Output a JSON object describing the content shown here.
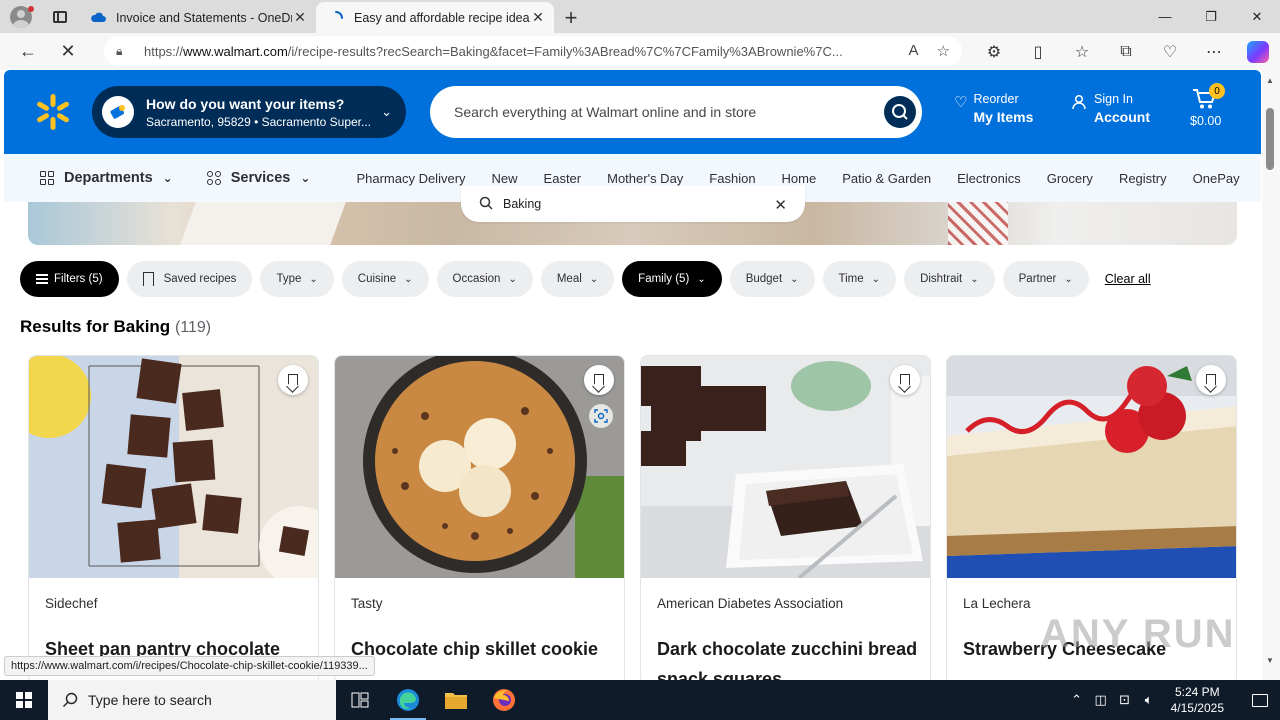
{
  "browser": {
    "tabs": [
      {
        "title": "Invoice and Statements - OneDri",
        "active": false
      },
      {
        "title": "Easy and affordable recipe ideas",
        "active": true
      }
    ],
    "url_prefix": "https://",
    "url_host": "www.walmart.com",
    "url_rest": "/i/recipe-results?recSearch=Baking&facet=Family%3ABread%7C%7CFamily%3ABrownie%7C...",
    "status_url": "https://www.walmart.com/i/recipes/Chocolate-chip-skillet-cookie/119339..."
  },
  "header": {
    "delivery_title": "How do you want your items?",
    "delivery_location": "Sacramento, 95829 • Sacramento Super...",
    "search_placeholder": "Search everything at Walmart online and in store",
    "reorder_small": "Reorder",
    "reorder_big": "My Items",
    "signin_small": "Sign In",
    "signin_big": "Account",
    "cart_count": "0",
    "cart_total": "$0.00",
    "brand_color": "#0071dc",
    "spark_color": "#ffc220"
  },
  "nav": {
    "departments": "Departments",
    "services": "Services",
    "links": [
      "Pharmacy Delivery",
      "New",
      "Easter",
      "Mother's Day",
      "Fashion",
      "Home",
      "Patio & Garden",
      "Electronics",
      "Grocery",
      "Registry",
      "OnePay"
    ]
  },
  "inpage_search": {
    "value": "Baking"
  },
  "filters": {
    "filters_label": "Filters (5)",
    "saved_label": "Saved recipes",
    "pills": [
      {
        "label": "Type",
        "active": false
      },
      {
        "label": "Cuisine",
        "active": false
      },
      {
        "label": "Occasion",
        "active": false
      },
      {
        "label": "Meal",
        "active": false
      },
      {
        "label": "Family (5)",
        "active": true
      },
      {
        "label": "Budget",
        "active": false
      },
      {
        "label": "Time",
        "active": false
      },
      {
        "label": "Dishtrait",
        "active": false
      },
      {
        "label": "Partner",
        "active": false
      }
    ],
    "clear_all": "Clear all"
  },
  "results": {
    "heading": "Results for Baking",
    "count": "(119)"
  },
  "cards": [
    {
      "source": "Sidechef",
      "name": "Sheet pan pantry chocolate",
      "image": "brownie-sheet-photo"
    },
    {
      "source": "Tasty",
      "name": "Chocolate chip skillet cookie",
      "image": "skillet-cookie-photo"
    },
    {
      "source": "American Diabetes Association",
      "name": "Dark chocolate zucchini bread snack squares",
      "image": "brownie-plate-photo"
    },
    {
      "source": "La Lechera",
      "name": "Strawberry Cheesecake",
      "image": "cheesecake-photo"
    }
  ],
  "watermark": "ANY RUN",
  "taskbar": {
    "search_placeholder": "Type here to search",
    "time": "5:24 PM",
    "date": "4/15/2025"
  }
}
